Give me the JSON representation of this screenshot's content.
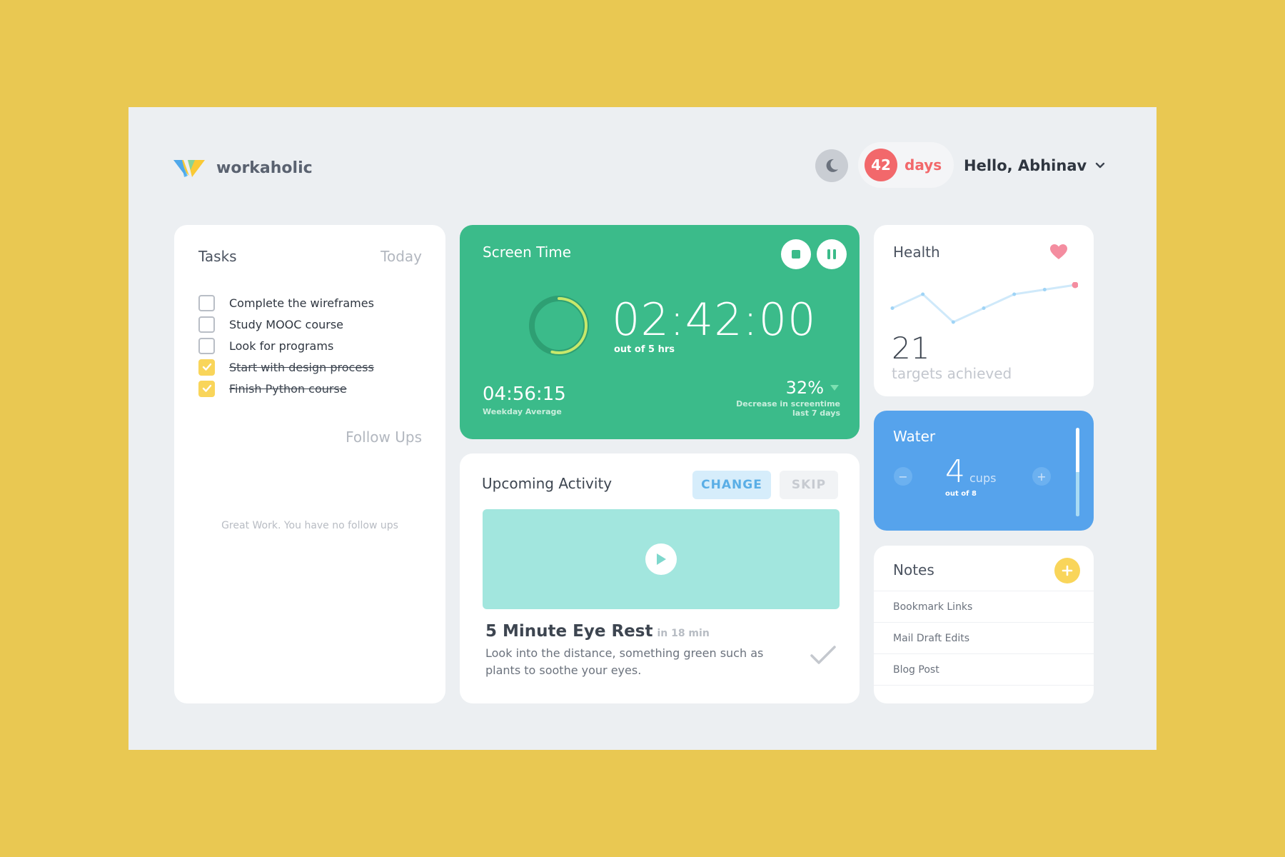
{
  "header": {
    "brand": "workaholic",
    "streak": {
      "count": "42",
      "label": "days"
    },
    "greeting": "Hello, Abhinav",
    "icons": {
      "theme": "moon-icon",
      "menu": "chevron-down-icon"
    }
  },
  "tasks": {
    "title": "Tasks",
    "filter": "Today",
    "items": [
      {
        "label": "Complete the wireframes",
        "done": false
      },
      {
        "label": "Study MOOC course",
        "done": false
      },
      {
        "label": "Look for programs",
        "done": false
      },
      {
        "label": "Start with design process",
        "done": true
      },
      {
        "label": "Finish Python course",
        "done": true
      }
    ],
    "followups_title": "Follow Ups",
    "followups_empty": "Great Work. You have no follow ups"
  },
  "screen_time": {
    "title": "Screen Time",
    "elapsed": "02:42:00",
    "limit_label": "out of 5 hrs",
    "progress_fraction": 0.54,
    "weekday_average": "04:56:15",
    "weekday_label": "Weekday Average",
    "change": "32%",
    "change_label": "Decrease in screentime",
    "change_period": "last 7 days"
  },
  "upcoming": {
    "title": "Upcoming Activity",
    "change_label": "CHANGE",
    "skip_label": "SKIP",
    "activity_title": "5 Minute Eye Rest",
    "activity_eta": "in 18 min",
    "activity_desc": "Look into the distance, something green such as plants to soothe your eyes."
  },
  "health": {
    "title": "Health",
    "count": "21",
    "label": "targets achieved",
    "trend": [
      6,
      3,
      9,
      6,
      3,
      2,
      1
    ]
  },
  "water": {
    "title": "Water",
    "cups": "4",
    "unit": "cups",
    "target_label": "out of 8",
    "fill_fraction": 0.5,
    "minus": "−",
    "plus": "+"
  },
  "notes": {
    "title": "Notes",
    "items": [
      "Bookmark Links",
      "Mail Draft Edits",
      "Blog Post"
    ]
  },
  "colors": {
    "background": "#E9C852",
    "screen_time": "#3BBB8A",
    "water": "#56A3EC",
    "accent_yellow": "#F9D55A",
    "streak_red": "#F2686B"
  }
}
